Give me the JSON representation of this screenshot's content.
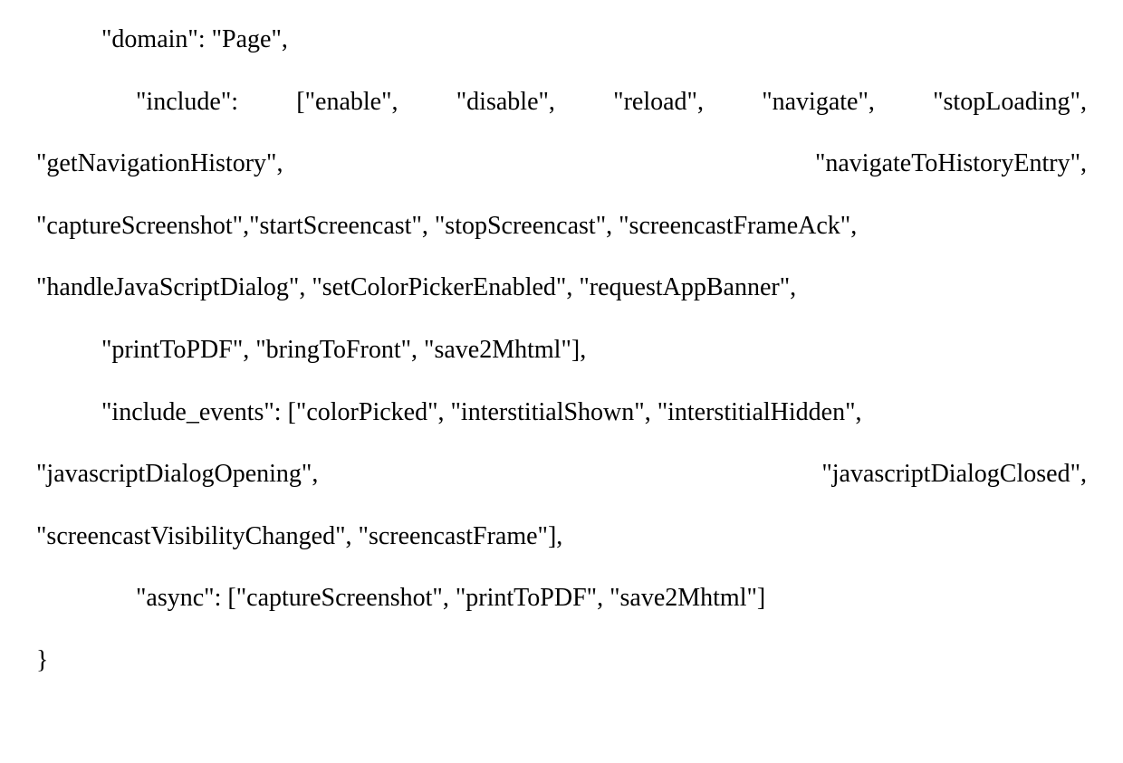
{
  "json_config": {
    "domain": "Page",
    "include": [
      "enable",
      "disable",
      "reload",
      "navigate",
      "stopLoading",
      "getNavigationHistory",
      "navigateToHistoryEntry",
      "captureScreenshot",
      "startScreencast",
      "stopScreencast",
      "screencastFrameAck",
      "handleJavaScriptDialog",
      "setColorPickerEnabled",
      "requestAppBanner",
      "printToPDF",
      "bringToFront",
      "save2Mhtml"
    ],
    "include_events": [
      "colorPicked",
      "interstitialShown",
      "interstitialHidden",
      "javascriptDialogOpening",
      "javascriptDialogClosed",
      "screencastVisibilityChanged",
      "screencastFrame"
    ],
    "async": [
      "captureScreenshot",
      "printToPDF",
      "save2Mhtml"
    ]
  },
  "lines": {
    "l1": "\"domain\": \"Page\",",
    "l2a": "\"include\":",
    "l2b": "[\"enable\",",
    "l2c": "\"disable\",",
    "l2d": "\"reload\",",
    "l2e": "\"navigate\",",
    "l2f": "\"stopLoading\",",
    "l3a": "\"getNavigationHistory\",",
    "l3b": "\"navigateToHistoryEntry\",",
    "l4": "\"captureScreenshot\",\"startScreencast\", \"stopScreencast\", \"screencastFrameAck\",",
    "l5": "\"handleJavaScriptDialog\", \"setColorPickerEnabled\", \"requestAppBanner\",",
    "l6": "\"printToPDF\", \"bringToFront\", \"save2Mhtml\"],",
    "l7": "\"include_events\": [\"colorPicked\", \"interstitialShown\", \"interstitialHidden\",",
    "l8a": "\"javascriptDialogOpening\",",
    "l8b": "\"javascriptDialogClosed\",",
    "l9": "\"screencastVisibilityChanged\", \"screencastFrame\"],",
    "l10": "\"async\": [\"captureScreenshot\", \"printToPDF\", \"save2Mhtml\"]",
    "l11": "}"
  }
}
